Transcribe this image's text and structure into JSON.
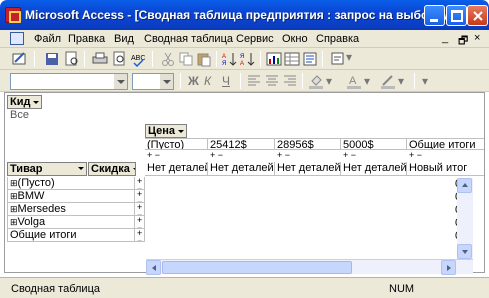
{
  "window": {
    "title": "Microsoft Access - [Сводная таблица предприятия : запрос на выборку]"
  },
  "menu": [
    "Файл",
    "Правка",
    "Вид",
    "Сводная таблица",
    "Сервис",
    "Окно",
    "Справка"
  ],
  "window_controls": {
    "minimize": "_",
    "restore": "в",
    "close": "×"
  },
  "pivot": {
    "filter_field": "Кид",
    "filter_value": "Все",
    "column_field": "Цена",
    "column_headers": [
      "(Пусто)",
      "25412$",
      "28956$",
      "5000$",
      "Общие итоги"
    ],
    "row_field": "Тивар",
    "data_field": "Скидка",
    "row_labels": [
      "(Пусто)",
      "BMW",
      "Mersedes",
      "Volga",
      "Общие итоги"
    ],
    "no_details": "Нет деталей",
    "new_total": "Новый итог",
    "totals_column": [
      "0",
      "0",
      "0",
      "0",
      "0"
    ]
  },
  "status": {
    "text": "Сводная таблица",
    "num": "NUM"
  }
}
